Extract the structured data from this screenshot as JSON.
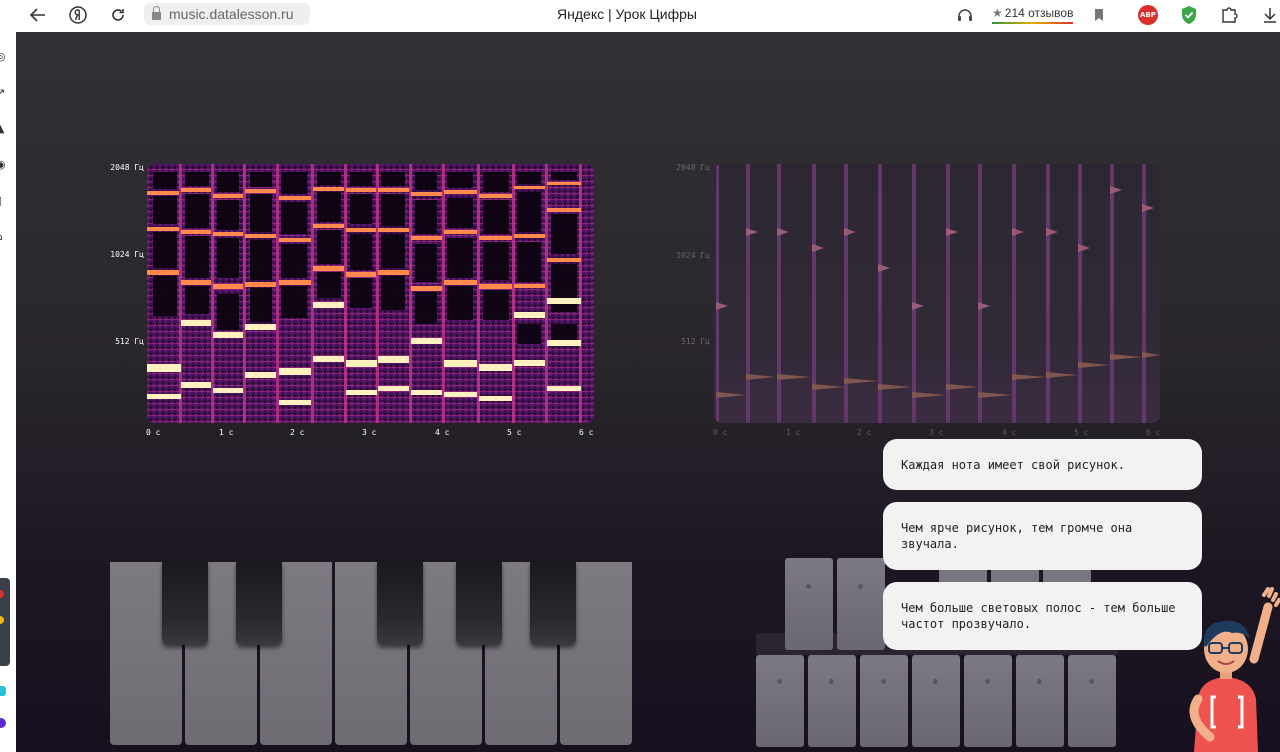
{
  "browser": {
    "url": "music.datalesson.ru",
    "title": "Яндекс | Урок Цифры",
    "reviews": "214 отзывов",
    "ext_abp": "ABP",
    "icons": [
      "back-arrow-icon",
      "yandex-icon",
      "reload-icon",
      "lock-icon",
      "headphones-icon",
      "star-icon",
      "bookmark-icon",
      "adblock-icon",
      "shield-icon",
      "extension-icon",
      "download-icon"
    ]
  },
  "spectrogram_left": {
    "y_ticks": [
      "2048 Гц",
      "1024 Гц",
      "512 Гц"
    ],
    "x_ticks": [
      "0 с",
      "1 с",
      "2 с",
      "3 с",
      "4 с",
      "5 с",
      "6 с"
    ]
  },
  "spectrogram_right": {
    "y_ticks": [
      "2048 Гц",
      "1024 Гц",
      "512 Гц"
    ],
    "x_ticks": [
      "0 с",
      "1 с",
      "2 с",
      "3 с",
      "4 с",
      "5 с",
      "6 с"
    ]
  },
  "bubbles": [
    "Каждая нота имеет свой рисунок.",
    "Чем ярче рисунок, тем громче она звучала.",
    "Чем больше световых полос - тем больше частот прозвучало."
  ],
  "colors": {
    "spectrogram_bright": "#fff3c4",
    "spectrogram_mid": "#ff7b4a",
    "spectrogram_low": "#9b2a8c",
    "background_top": "#333135",
    "background_bottom": "#17101f",
    "mascot_shirt": "#ef5350"
  }
}
